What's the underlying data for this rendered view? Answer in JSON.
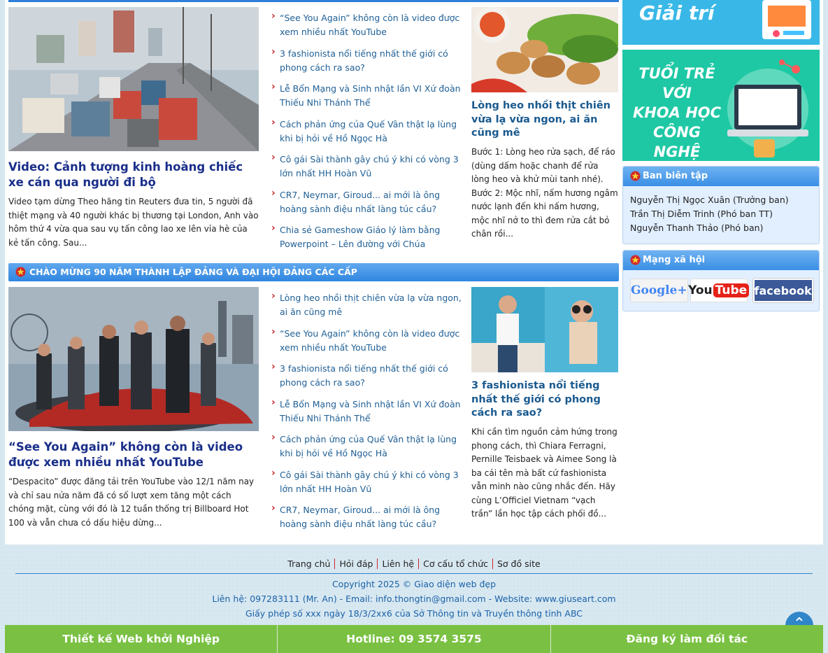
{
  "section1": {
    "featured": {
      "title": "Video: Cảnh tượng kinh hoàng chiếc xe cán qua người đi bộ",
      "desc": "Video tạm dừng Theo hãng tin Reuters đưa tin, 5 người đã thiệt mạng và 40 người khác bị thương tại London, Anh vào hôm thứ 4 vừa qua sau vụ tấn công lao xe lên vỉa hè của kẻ tấn công. Sau..."
    },
    "links": [
      "“See You Again” không còn là video được xem nhiều nhất YouTube",
      "3 fashionista nổi tiếng nhất thế giới có phong cách ra sao?",
      "Lễ Bổn Mạng và Sinh nhật lần VI Xứ đoàn Thiếu Nhi Thánh Thể",
      "Cách phản ứng của Quế Vân thật lạ lùng khi bị hỏi về Hồ Ngọc Hà",
      "Cô gái Sài thành gây chú ý khi có vòng 3 lớn nhất HH Hoàn Vũ",
      "CR7, Neymar, Giroud... ai mới là ông hoàng sành điệu nhất làng túc cầu?",
      "Chia sẻ Gameshow Giáo lý làm bằng Powerpoint – Lên đường với Chúa"
    ],
    "side": {
      "title": "Lòng heo nhồi thịt chiên vừa lạ vừa ngon, ai ăn cũng mê",
      "desc": "Bước 1: Lòng heo rửa sạch, để ráo (dùng dấm hoặc chanh để rửa lòng heo và khử mùi tanh nhé). Bước 2: Mộc nhĩ, nấm hương ngâm nước lạnh đến khi nấm hương, mộc nhĩ nở to thì đem rửa cắt bỏ chân rồi..."
    }
  },
  "section2": {
    "category": "CHÀO MỪNG 90 NĂM THÀNH LẬP ĐẢNG VÀ ĐẠI HỘI ĐẢNG CÁC CẤP",
    "featured": {
      "title": "“See You Again” không còn là video được xem nhiều nhất YouTube",
      "desc": "“Despacito” được đăng tải trên YouTube vào 12/1 năm nay và chỉ sau nửa năm đã có số lượt xem tăng một cách chóng mặt, cùng với đó là 12 tuần thống trị Billboard Hot 100 và vẫn chưa có dấu hiệu dừng..."
    },
    "links": [
      "Lòng heo nhồi thịt chiên vừa lạ vừa ngon, ai ăn cũng mê",
      "“See You Again” không còn là video được xem nhiều nhất YouTube",
      "3 fashionista nổi tiếng nhất thế giới có phong cách ra sao?",
      "Lễ Bổn Mạng và Sinh nhật lần VI Xứ đoàn Thiếu Nhi Thánh Thể",
      "Cách phản ứng của Quế Vân thật lạ lùng khi bị hỏi về Hồ Ngọc Hà",
      "Cô gái Sài thành gây chú ý khi có vòng 3 lớn nhất HH Hoàn Vũ",
      "CR7, Neymar, Giroud... ai mới là ông hoàng sành điệu nhất làng túc cầu?"
    ],
    "side": {
      "title": "3 fashionista nổi tiếng nhất thế giới có phong cách ra sao?",
      "desc": "Khi cần tìm nguồn cảm hứng trong phong cách, thì Chiara Ferragni, Pernille Teisbaek và Aimee Song là ba cái tên mà bất cứ fashionista vẫn minh nào cũng nhắc đến. Hãy cùng L’Officiel Vietnam “vạch trần” lần học tập cách phối đồ..."
    }
  },
  "sidebar": {
    "banner1_text": "Giải trí",
    "banner2_lines": [
      "TUỔI TRẺ",
      "VỚI",
      "KHOA HỌC",
      "CÔNG NGHỆ"
    ],
    "editors_title": "Ban biên tập",
    "editors": [
      "Nguyễn Thị Ngọc Xuân (Trưởng ban)",
      "Trần Thị Diễm Trinh (Phó ban TT)",
      "Nguyễn Thanh Thảo (Phó ban)"
    ],
    "social_title": "Mạng xã hội",
    "social": {
      "google": "Google+",
      "youtube_you": "You",
      "youtube_tube": "Tube",
      "facebook": "facebook"
    }
  },
  "footer": {
    "links": [
      "Trang chủ",
      "Hỏi đáp",
      "Liên hệ",
      "Cơ cấu tổ chức",
      "Sơ đồ site"
    ],
    "copyright": "Copyright 2025 © Giao diện web đẹp",
    "contact": "Liên hệ: 097283111 (Mr. An) - Email: info.thongtin@gmail.com - Website: www.giuseart.com",
    "license": "Giấy phép số xxx ngày 18/3/2xx6 của Sở Thông tin và Truyền thông tỉnh ABC",
    "bottom_bar": [
      "Thiết kế Web khởi Nghiệp",
      "Hotline: 09 3574 3575",
      "Đăng ký làm đối tác"
    ]
  },
  "colors": {
    "accent": "#2f86e0",
    "link": "#1f5f95",
    "title": "#1a2f8a",
    "cta": "#7ac143",
    "bullet": "#c9252b"
  }
}
